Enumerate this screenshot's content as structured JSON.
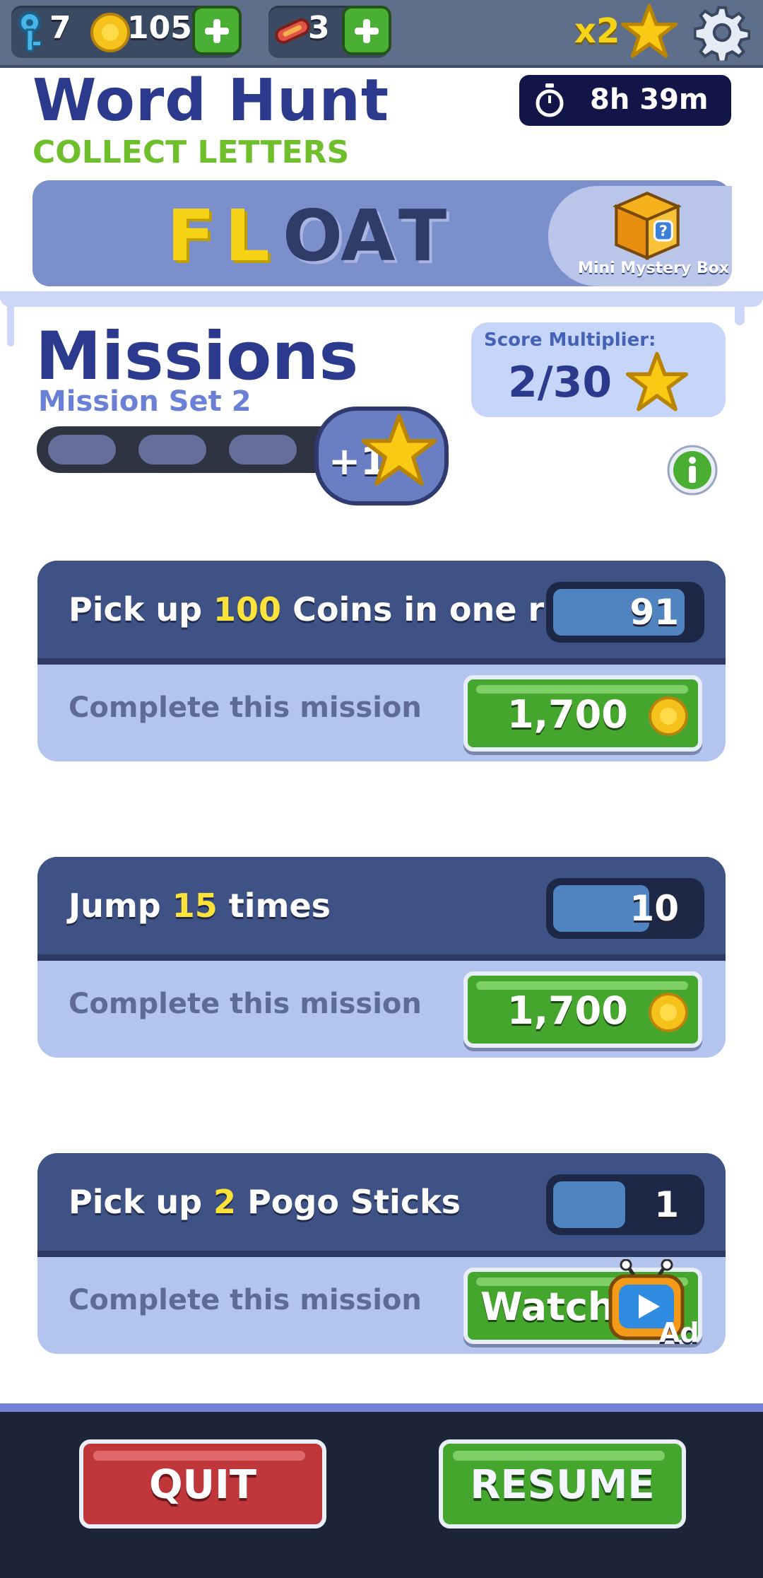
{
  "currencies": {
    "keys": "7",
    "coins": "105",
    "boards": "3"
  },
  "multiplier_label": "x2",
  "event": {
    "title": "Word Hunt",
    "subtitle": "COLLECT LETTERS",
    "timer": "8h 39m",
    "word_letters": [
      "F",
      "L",
      "O",
      "A",
      "T"
    ],
    "found_letters": 2,
    "prize_label": "Mini Mystery Box"
  },
  "missions": {
    "title": "Missions",
    "set_label": "Mission Set 2",
    "progress_completed": 0,
    "progress_total": 3,
    "bonus_label": "+1",
    "score_label": "Score Multiplier:",
    "score_value": "2/30",
    "items": [
      {
        "prefix": "Pick up ",
        "target": "100",
        "suffix": " Coins in one run",
        "count": "91",
        "progress_fraction": 0.91,
        "complete_label": "Complete this mission",
        "reward": "1,700"
      },
      {
        "prefix": "Jump ",
        "target": "15",
        "suffix": " times",
        "count": "10",
        "progress_fraction": 0.667,
        "complete_label": "Complete this mission",
        "reward": "1,700"
      },
      {
        "prefix": "Pick up ",
        "target": "2",
        "suffix": " Pogo Sticks",
        "count": "1",
        "progress_fraction": 0.5,
        "complete_label": "Complete this mission",
        "watch_label": "Watch",
        "ad_label": "Ad"
      }
    ]
  },
  "buttons": {
    "quit": "QUIT",
    "resume": "RESUME"
  },
  "colors": {
    "accent_green": "#44a62c",
    "quit_red": "#c0373b",
    "title_navy": "#2b3a8c",
    "highlight_yellow": "#fde23a"
  },
  "icons": [
    "key-icon",
    "coin-icon",
    "hoverboard-icon",
    "plus-icon",
    "star-icon",
    "gear-icon",
    "stopwatch-icon",
    "mystery-box-icon",
    "info-icon",
    "tv-ad-icon"
  ]
}
